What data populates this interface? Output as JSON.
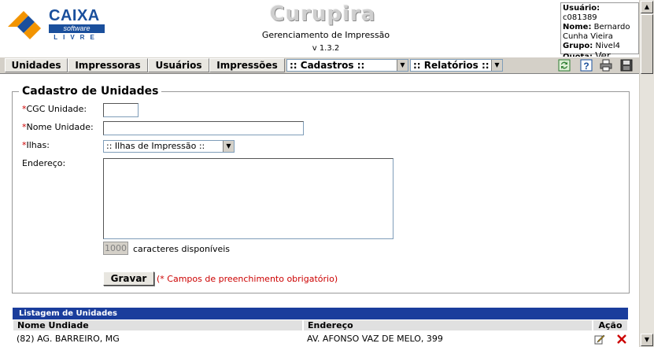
{
  "header": {
    "logo": {
      "brand": "CAIXA",
      "tagline": "software",
      "sub": "LIVRE"
    },
    "app_name": "Curupira",
    "subtitle": "Gerenciamento de Impressão",
    "version": "v 1.3.2",
    "user": {
      "usuario_label": "Usuário:",
      "usuario_value": "c081389",
      "nome_label": "Nome:",
      "nome_value": "Bernardo Cunha Vieira",
      "grupo_label": "Grupo:",
      "grupo_value": "Nivel4",
      "quota_label": "Quota:",
      "quota_link": "Ver"
    }
  },
  "menu": {
    "items": [
      "Unidades",
      "Impressoras",
      "Usuários",
      "Impressões"
    ],
    "cadastros": ":: Cadastros ::",
    "relatorios": ":: Relatórios ::",
    "icons": [
      "refresh-icon",
      "help-icon",
      "print-icon",
      "save-icon"
    ]
  },
  "form": {
    "legend": "Cadastro de Unidades",
    "required_mark": "*",
    "cgc_label": "CGC Unidade:",
    "nome_label": "Nome Unidade:",
    "ilhas_label": "Ilhas:",
    "ilhas_selected": ":: Ilhas de Impressão ::",
    "endereco_label": "Endereço:",
    "counter_value": "1000",
    "counter_label": "caracteres disponíveis",
    "submit_label": "Gravar",
    "required_note": "(* Campos de preenchimento obrigatório)"
  },
  "listing": {
    "title": "Listagem de Unidades",
    "columns": [
      "Nome Undiade",
      "Endereço",
      "Ação"
    ],
    "rows": [
      {
        "nome": "(82) AG. BARREIRO, MG",
        "endereco": "AV. AFONSO VAZ DE MELO, 399"
      }
    ]
  },
  "colors": {
    "brand_blue": "#1a4f9c",
    "required_red": "#cc0000",
    "list_header_blue": "#1a3d9c",
    "toolbar_grey": "#d4d0c8"
  }
}
